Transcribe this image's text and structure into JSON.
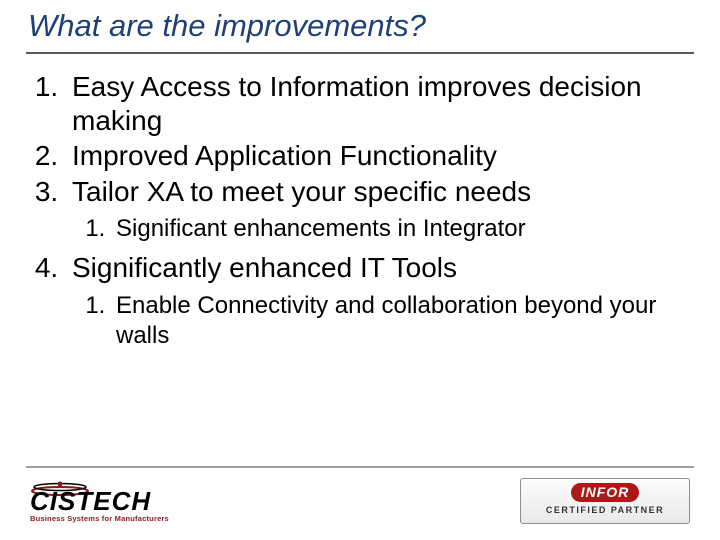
{
  "title": "What are the improvements?",
  "items": {
    "i1": "Easy Access to Information improves decision making",
    "i2": "Improved Application Functionality",
    "i3": "Tailor XA to meet your specific needs",
    "i3_sub1": "Significant enhancements in Integrator",
    "i4": "Significantly enhanced IT Tools",
    "i4_sub1": "Enable Connectivity and collaboration beyond your walls"
  },
  "logos": {
    "cistech_name": "CISTECH",
    "cistech_tagline": "Business Systems for Manufacturers",
    "infor_name": "INFOR",
    "infor_sub": "CERTIFIED PARTNER"
  }
}
